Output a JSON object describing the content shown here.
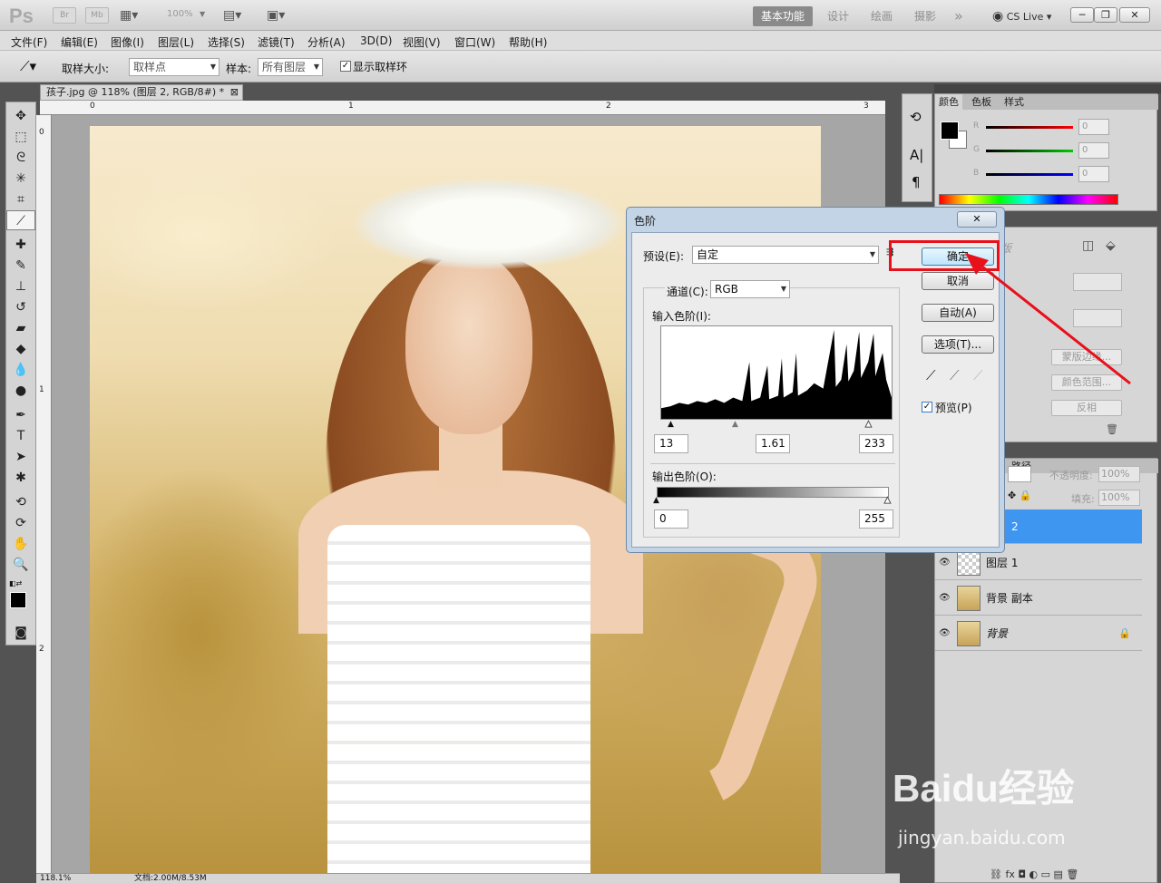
{
  "app": {
    "logo": "Ps"
  },
  "titlebar": {
    "buttons": [
      "Br",
      "Mb"
    ],
    "zoom": "100%",
    "workspaces": [
      "基本功能",
      "设计",
      "绘画",
      "摄影"
    ],
    "more": "»",
    "cslive": "CS Live"
  },
  "menu": [
    "文件(F)",
    "编辑(E)",
    "图像(I)",
    "图层(L)",
    "选择(S)",
    "滤镜(T)",
    "分析(A)",
    "3D(D)",
    "视图(V)",
    "窗口(W)",
    "帮助(H)"
  ],
  "options": {
    "sample_size_label": "取样大小:",
    "sample_size_value": "取样点",
    "sample_label": "样本:",
    "sample_value": "所有图层",
    "show_ring_label": "显示取样环"
  },
  "document": {
    "tab_title": "孩子.jpg @ 118% (图层 2, RGB/8#) *",
    "ruler_h_labels": [
      "0",
      "1",
      "2",
      "3"
    ],
    "ruler_v_labels": [
      "0",
      "1",
      "2"
    ],
    "zoom": "118.1%",
    "docinfo": "文档:2.00M/8.53M"
  },
  "color_panel": {
    "tabs": [
      "颜色",
      "色板",
      "样式"
    ],
    "channels": [
      {
        "label": "R",
        "value": "0"
      },
      {
        "label": "G",
        "value": "0"
      },
      {
        "label": "B",
        "value": "0"
      }
    ]
  },
  "adjust_panel": {
    "title": "蒙版",
    "buttons": [
      "蒙版边缘...",
      "颜色范围...",
      "反相"
    ]
  },
  "layers_panel": {
    "tab": "路径",
    "opacity_label": "不透明度:",
    "opacity_value": "100%",
    "fill_label": "填充:",
    "fill_value": "100%",
    "layers": [
      {
        "name": "2",
        "selected": true
      },
      {
        "name": "图层 1",
        "selected": false
      },
      {
        "name": "背景 副本",
        "selected": false
      },
      {
        "name": "背景",
        "selected": false,
        "locked": true
      }
    ]
  },
  "levels_dialog": {
    "title": "色阶",
    "preset_label": "预设(E):",
    "preset_value": "自定",
    "channel_label": "通道(C):",
    "channel_value": "RGB",
    "input_label": "输入色阶(I):",
    "input_black": "13",
    "input_gamma": "1.61",
    "input_white": "233",
    "output_label": "输出色阶(O):",
    "output_black": "0",
    "output_white": "255",
    "buttons": {
      "ok": "确定",
      "cancel": "取消",
      "auto": "自动(A)",
      "options": "选项(T)..."
    },
    "preview_label": "预览(P)",
    "preview_checked": true
  },
  "watermark": {
    "brand": "Baidu经验",
    "url": "jingyan.baidu.com"
  }
}
